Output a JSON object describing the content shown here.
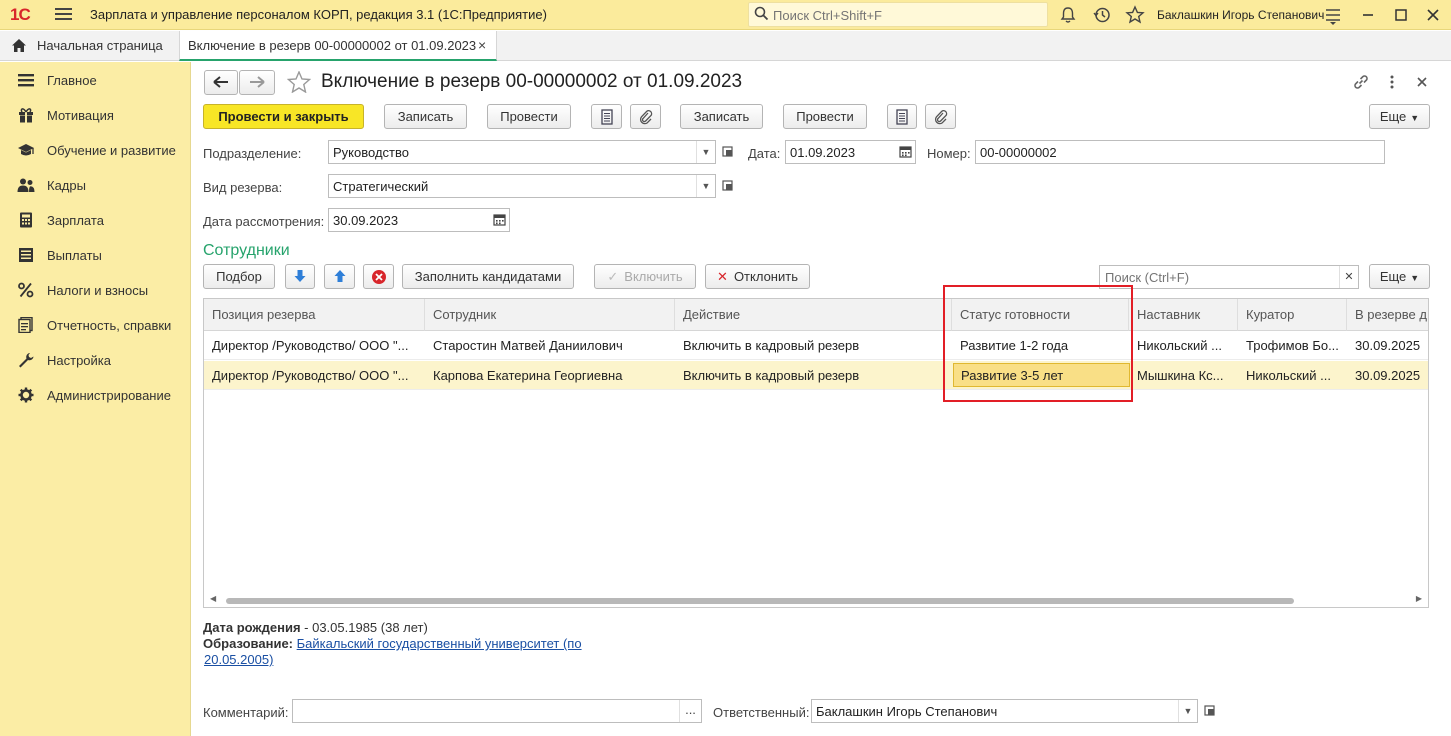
{
  "titlebar": {
    "logo": "1С",
    "app_title": "Зарплата и управление персоналом КОРП, редакция 3.1  (1С:Предприятие)",
    "search_placeholder": "Поиск Ctrl+Shift+F",
    "user_name": "Баклашкин Игорь Степанович",
    "icons": [
      "bell-icon",
      "history-icon",
      "star-icon",
      "settings-icon",
      "minimize-icon",
      "maximize-icon",
      "close-icon"
    ]
  },
  "tabs": {
    "home": "Начальная страница",
    "doc": "Включение в резерв 00-00000002 от 01.09.2023",
    "close": "×"
  },
  "sidebar": {
    "items": [
      {
        "label": "Главное",
        "icon": "menu-icon"
      },
      {
        "label": "Мотивация",
        "icon": "gift-icon"
      },
      {
        "label": "Обучение и развитие",
        "icon": "graduation-icon"
      },
      {
        "label": "Кадры",
        "icon": "people-icon"
      },
      {
        "label": "Зарплата",
        "icon": "calculator-icon"
      },
      {
        "label": "Выплаты",
        "icon": "list-icon"
      },
      {
        "label": "Налоги и взносы",
        "icon": "percent-icon"
      },
      {
        "label": "Отчетность, справки",
        "icon": "report-icon"
      },
      {
        "label": "Настройка",
        "icon": "wrench-icon"
      },
      {
        "label": "Администрирование",
        "icon": "gear-icon"
      }
    ]
  },
  "doc": {
    "title": "Включение в резерв 00-00000002 от 01.09.2023",
    "header_icons": [
      "link-icon",
      "more-icon",
      "close-icon"
    ]
  },
  "toolbar": {
    "post_close": "Провести и закрыть",
    "save": "Записать",
    "post": "Провести",
    "save2": "Записать",
    "post2": "Провести",
    "more": "Еще"
  },
  "form": {
    "division_label": "Подразделение:",
    "division_value": "Руководство",
    "date_label": "Дата:",
    "date_value": "01.09.2023",
    "number_label": "Номер:",
    "number_value": "00-00000002",
    "reserve_type_label": "Вид резерва:",
    "reserve_type_value": "Стратегический",
    "review_date_label": "Дата рассмотрения:",
    "review_date_value": "30.09.2023"
  },
  "employees": {
    "section_title": "Сотрудники",
    "select_btn": "Подбор",
    "fill_btn": "Заполнить кандидатами",
    "include_btn": "Включить",
    "reject_btn": "Отклонить",
    "search_placeholder": "Поиск (Ctrl+F)",
    "more": "Еще",
    "columns": [
      "Позиция резерва",
      "Сотрудник",
      "Действие",
      "Статус готовности",
      "Наставник",
      "Куратор",
      "В резерве д"
    ],
    "rows": [
      [
        "Директор /Руководство/ ООО \"...",
        "Старостин Матвей Даниилович",
        "Включить в кадровый резерв",
        "Развитие 1-2 года",
        "Никольский ...",
        "Трофимов Бо...",
        "30.09.2025"
      ],
      [
        "Директор /Руководство/ ООО \"...",
        "Карпова Екатерина Георгиевна",
        "Включить в кадровый резерв",
        "Развитие 3-5 лет",
        "Мышкина Кс...",
        "Никольский ...",
        "30.09.2025"
      ]
    ]
  },
  "details": {
    "birth_label": "Дата рождения",
    "birth_value": " - 03.05.1985 (38 лет)",
    "edu_label": "Образование:",
    "edu_link_1": "Байкальский государственный университет (по",
    "edu_link_2": "20.05.2005)"
  },
  "footer": {
    "comment_label": "Комментарий:",
    "comment_value": "",
    "comment_btn": "...",
    "responsible_label": "Ответственный:",
    "responsible_value": "Баклашкин Игорь Степанович"
  },
  "colors": {
    "titlebar": "#fbeb9c",
    "sidebar": "#fbeda5",
    "primary_button": "#f8e626",
    "section_title": "#26a36c",
    "highlight_box": "#e21e26",
    "selected_row": "#fcf4cc"
  }
}
